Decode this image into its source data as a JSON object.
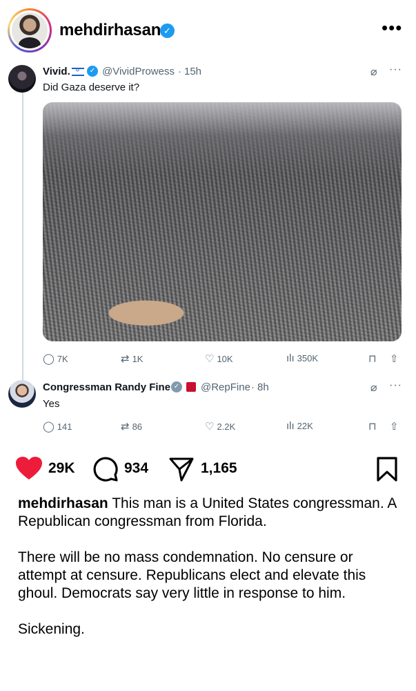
{
  "post": {
    "username": "mehdirhasan",
    "more_icon": "more-horizontal-icon"
  },
  "tweets": [
    {
      "name": "Vivid.",
      "handle": "@VividProwess",
      "dot": "·",
      "time": "15h",
      "text": "Did Gaza deserve it?",
      "stats": {
        "replies": "7K",
        "reposts": "1K",
        "likes": "10K",
        "views": "350K"
      }
    },
    {
      "name": "Congressman Randy Fine",
      "handle": "@RepFine",
      "dot": "·",
      "time": "8h",
      "text": "Yes",
      "stats": {
        "replies": "141",
        "reposts": "86",
        "likes": "2.2K",
        "views": "22K"
      }
    }
  ],
  "engagement": {
    "likes": "29K",
    "comments": "934",
    "shares": "1,165",
    "heart_color": "#ed1c3a"
  },
  "caption": {
    "username": "mehdirhasan",
    "paragraph1": "This man is a United States congressman. A Republican congressman from Florida.",
    "paragraph2": "There will be no mass condemnation. No censure or attempt at censure. Republicans elect and elevate this ghoul. Democrats say very little in response to him.",
    "paragraph3": "Sickening."
  },
  "colors": {
    "verified_blue": "#1d9bf0",
    "x_gray": "#536471"
  }
}
